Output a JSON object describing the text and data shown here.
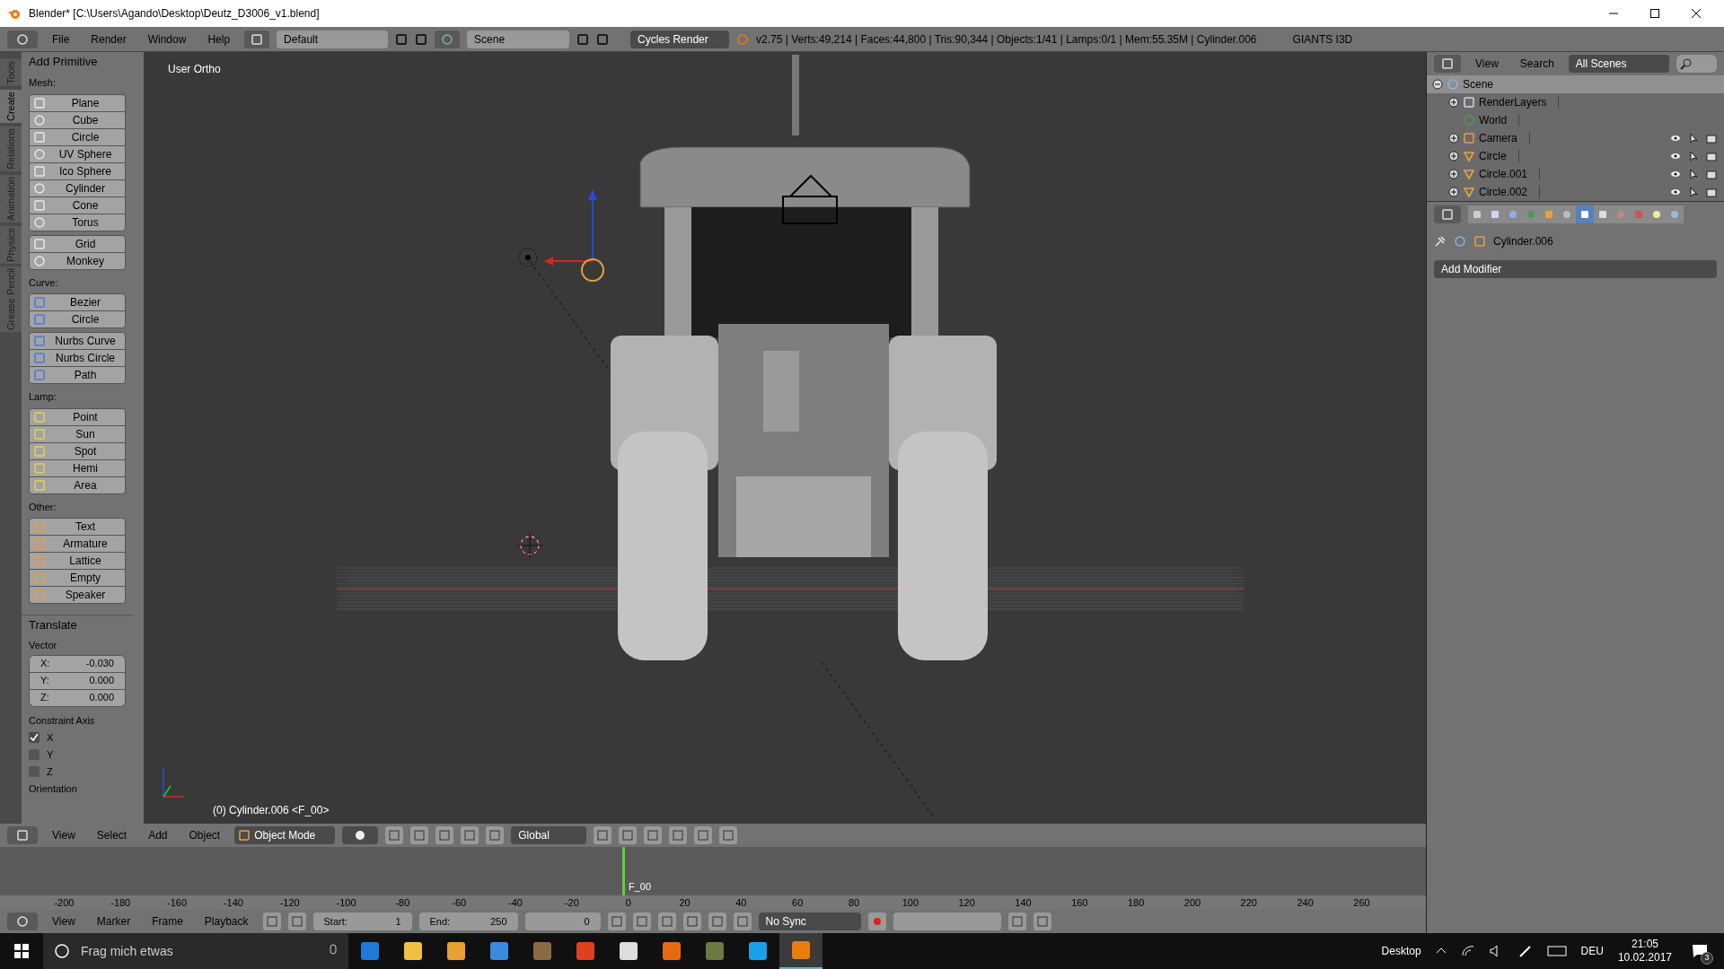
{
  "window": {
    "title": "Blender* [C:\\Users\\Agando\\Desktop\\Deutz_D3006_v1.blend]"
  },
  "info_header": {
    "menus": [
      "File",
      "Render",
      "Window",
      "Help"
    ],
    "screen_layout": "Default",
    "scene": "Scene",
    "render_engine": "Cycles Render",
    "stats": "v2.75 | Verts:49,214 | Faces:44,800 | Tris:90,344 | Objects:1/41 | Lamps:0/1 | Mem:55.35M | Cylinder.006",
    "addon": "GIANTS I3D"
  },
  "tool_tabs": [
    {
      "label": "Tools",
      "selected": false
    },
    {
      "label": "Create",
      "selected": true
    },
    {
      "label": "Relations",
      "selected": false
    },
    {
      "label": "Animation",
      "selected": false
    },
    {
      "label": "Physics",
      "selected": false
    },
    {
      "label": "Grease Pencil",
      "selected": false
    }
  ],
  "add_primitive": {
    "title": "Add Primitive",
    "groups": [
      {
        "label": "Mesh:",
        "blocks": [
          [
            "Plane",
            "Cube",
            "Circle",
            "UV Sphere",
            "Ico Sphere",
            "Cylinder",
            "Cone",
            "Torus"
          ],
          [
            "Grid",
            "Monkey"
          ]
        ]
      },
      {
        "label": "Curve:",
        "blocks": [
          [
            "Bezier",
            "Circle"
          ],
          [
            "Nurbs Curve",
            "Nurbs Circle",
            "Path"
          ]
        ]
      },
      {
        "label": "Lamp:",
        "blocks": [
          [
            "Point",
            "Sun",
            "Spot",
            "Hemi",
            "Area"
          ]
        ]
      },
      {
        "label": "Other:",
        "blocks": [
          [
            "Text",
            "Armature",
            "Lattice",
            "Empty",
            "Speaker"
          ]
        ]
      }
    ]
  },
  "translate": {
    "title": "Translate",
    "vector_label": "Vector",
    "fields": [
      {
        "axis": "X:",
        "value": "-0.030"
      },
      {
        "axis": "Y:",
        "value": "0.000"
      },
      {
        "axis": "Z:",
        "value": "0.000"
      }
    ],
    "constraint_label": "Constraint Axis",
    "constraints": [
      {
        "label": "X",
        "checked": true
      },
      {
        "label": "Y",
        "checked": false
      },
      {
        "label": "Z",
        "checked": false
      }
    ],
    "orientation_label": "Orientation"
  },
  "viewport": {
    "label": "User Ortho",
    "status": "(0) Cylinder.006 <F_00>"
  },
  "view3d_header": {
    "menus": [
      "View",
      "Select",
      "Add",
      "Object"
    ],
    "mode": "Object Mode",
    "orientation": "Global"
  },
  "timeline": {
    "ticks": [
      "-200",
      "-180",
      "-160",
      "-140",
      "-120",
      "-100",
      "-80",
      "-60",
      "-40",
      "-20",
      "0",
      "20",
      "40",
      "60",
      "80",
      "100",
      "120",
      "140",
      "160",
      "180",
      "200",
      "220",
      "240",
      "260"
    ],
    "frame_label": "F_00"
  },
  "timeline_header": {
    "menus": [
      "View",
      "Marker",
      "Frame",
      "Playback"
    ],
    "start_label": "Start:",
    "start": "1",
    "end_label": "End:",
    "end": "250",
    "current": "0",
    "sync": "No Sync"
  },
  "outliner": {
    "menus": [
      "View",
      "Search"
    ],
    "filter": "All Scenes",
    "items": [
      {
        "name": "Scene",
        "kind": "scene",
        "selected": true,
        "expanded": true,
        "children": [
          {
            "name": "RenderLayers",
            "kind": "layers",
            "selected": false,
            "expanded": false
          },
          {
            "name": "World",
            "kind": "world",
            "selected": false
          },
          {
            "name": "Camera",
            "kind": "camera",
            "selected": false,
            "expanded": false
          },
          {
            "name": "Circle",
            "kind": "mesh",
            "selected": false,
            "expanded": false
          },
          {
            "name": "Circle.001",
            "kind": "mesh",
            "selected": false,
            "expanded": false
          },
          {
            "name": "Circle.002",
            "kind": "mesh",
            "selected": false,
            "expanded": false
          }
        ]
      }
    ]
  },
  "properties": {
    "tabs": [
      {
        "kind": "render",
        "selected": false
      },
      {
        "kind": "layers",
        "selected": false
      },
      {
        "kind": "scene",
        "selected": false
      },
      {
        "kind": "world",
        "selected": false
      },
      {
        "kind": "object",
        "selected": false
      },
      {
        "kind": "constraints",
        "selected": false
      },
      {
        "kind": "modifiers",
        "selected": true
      },
      {
        "kind": "data",
        "selected": false
      },
      {
        "kind": "material",
        "selected": false
      },
      {
        "kind": "texture",
        "selected": false
      },
      {
        "kind": "particles",
        "selected": false
      },
      {
        "kind": "physics",
        "selected": false
      }
    ],
    "object": "Cylinder.006",
    "add_modifier": "Add Modifier"
  },
  "taskbar": {
    "search_placeholder": "Frag mich etwas",
    "desktop": "Desktop",
    "language": "DEU",
    "time": "21:05",
    "date": "10.02.2017",
    "notifications": "3"
  }
}
